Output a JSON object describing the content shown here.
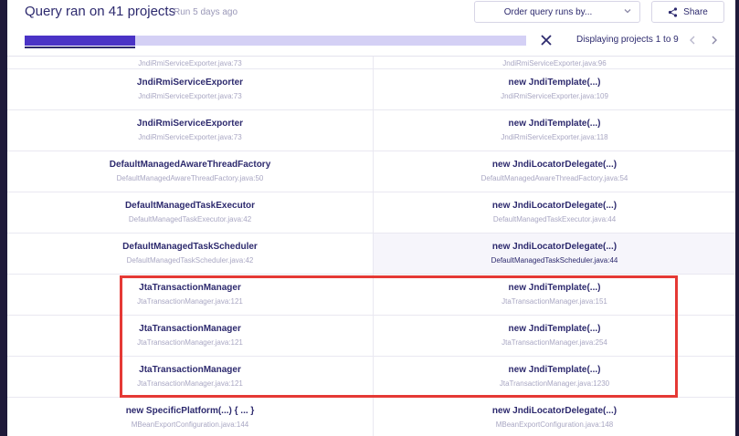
{
  "header": {
    "title": "Query ran on 41 projects",
    "run_info": "Run 5 days ago",
    "order_button": "Order query runs by...",
    "share_button": "Share",
    "display_text": "Displaying projects 1 to 9",
    "progress_fraction": 0.22
  },
  "rows": [
    {
      "left": {
        "main": "",
        "sub": "JndiRmiServiceExporter.java:73"
      },
      "right": {
        "main": "",
        "sub": "JndiRmiServiceExporter.java:96"
      }
    },
    {
      "left": {
        "main": "JndiRmiServiceExporter",
        "sub": "JndiRmiServiceExporter.java:73"
      },
      "right": {
        "main": "new JndiTemplate(...)",
        "sub": "JndiRmiServiceExporter.java:109"
      }
    },
    {
      "left": {
        "main": "JndiRmiServiceExporter",
        "sub": "JndiRmiServiceExporter.java:73"
      },
      "right": {
        "main": "new JndiTemplate(...)",
        "sub": "JndiRmiServiceExporter.java:118"
      }
    },
    {
      "left": {
        "main": "DefaultManagedAwareThreadFactory",
        "sub": "DefaultManagedAwareThreadFactory.java:50"
      },
      "right": {
        "main": "new JndiLocatorDelegate(...)",
        "sub": "DefaultManagedAwareThreadFactory.java:54"
      }
    },
    {
      "left": {
        "main": "DefaultManagedTaskExecutor",
        "sub": "DefaultManagedTaskExecutor.java:42"
      },
      "right": {
        "main": "new JndiLocatorDelegate(...)",
        "sub": "DefaultManagedTaskExecutor.java:44"
      }
    },
    {
      "left": {
        "main": "DefaultManagedTaskScheduler",
        "sub": "DefaultManagedTaskScheduler.java:42"
      },
      "right": {
        "main": "new JndiLocatorDelegate(...)",
        "sub": "DefaultManagedTaskScheduler.java:44"
      }
    },
    {
      "left": {
        "main": "JtaTransactionManager",
        "sub": "JtaTransactionManager.java:121"
      },
      "right": {
        "main": "new JndiTemplate(...)",
        "sub": "JtaTransactionManager.java:151"
      }
    },
    {
      "left": {
        "main": "JtaTransactionManager",
        "sub": "JtaTransactionManager.java:121"
      },
      "right": {
        "main": "new JndiTemplate(...)",
        "sub": "JtaTransactionManager.java:254"
      }
    },
    {
      "left": {
        "main": "JtaTransactionManager",
        "sub": "JtaTransactionManager.java:121"
      },
      "right": {
        "main": "new JndiTemplate(...)",
        "sub": "JtaTransactionManager.java:1230"
      }
    },
    {
      "left": {
        "main": "new SpecificPlatform(...) { ... }",
        "sub": "MBeanExportConfiguration.java:144"
      },
      "right": {
        "main": "new JndiLocatorDelegate(...)",
        "sub": "MBeanExportConfiguration.java:148"
      }
    }
  ],
  "colors": {
    "accent": "#4a33c6",
    "progress_track": "#d4d0f5",
    "highlight_box": "#e53935",
    "text_primary": "#2d2a6e"
  },
  "icons": {
    "order_chevron": "chevron-down-icon",
    "share": "share-icon",
    "close": "close-icon",
    "prev": "chevron-left-icon",
    "next": "chevron-right-icon"
  }
}
